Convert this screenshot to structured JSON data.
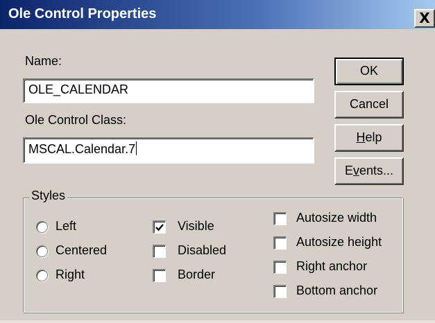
{
  "window": {
    "title": "Ole Control Properties",
    "close_glyph": "X"
  },
  "form": {
    "name_label": "Name:",
    "name_value": "OLE_CALENDAR",
    "class_label": "Ole Control Class:",
    "class_value": "MSCAL.Calendar.7"
  },
  "buttons": {
    "ok": "OK",
    "cancel": "Cancel",
    "help_mnemonic": "H",
    "help_rest": "elp",
    "events_pre": "E",
    "events_mnemonic": "v",
    "events_rest": "ents..."
  },
  "styles": {
    "legend": "Styles",
    "alignment": [
      {
        "label": "Left",
        "selected": false
      },
      {
        "label": "Centered",
        "selected": false
      },
      {
        "label": "Right",
        "selected": false
      }
    ],
    "flags": [
      {
        "label": "Visible",
        "checked": true
      },
      {
        "label": "Disabled",
        "checked": false
      },
      {
        "label": "Border",
        "checked": false
      }
    ],
    "autosize": [
      {
        "label": "Autosize width",
        "checked": false
      },
      {
        "label": "Autosize height",
        "checked": false
      },
      {
        "label": "Right anchor",
        "checked": false
      },
      {
        "label": "Bottom anchor",
        "checked": false
      }
    ]
  },
  "colors": {
    "titlebar_start": "#0a246a",
    "titlebar_end": "#a6caf0",
    "dialog_bg": "#d4d0c8"
  }
}
